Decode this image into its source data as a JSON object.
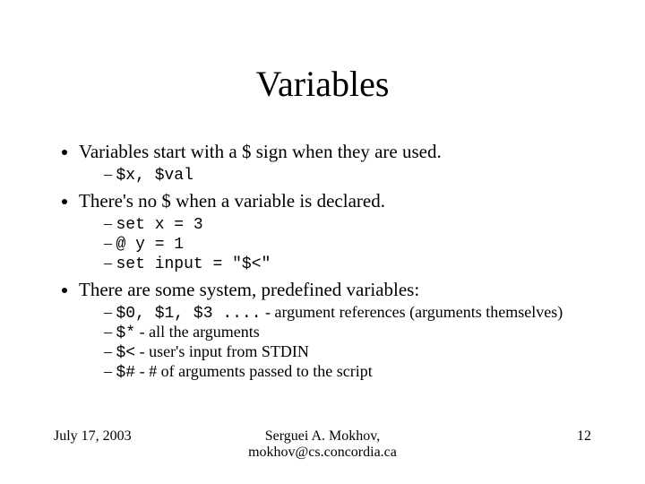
{
  "title": "Variables",
  "bullets": {
    "b1": "Variables start with a $ sign when they are used.",
    "b1_sub1": "$x, $val",
    "b2": " There's no $ when a variable is declared.",
    "b2_sub1": "set x = 3",
    "b2_sub2": "@ y = 1",
    "b2_sub3": "set input = \"$<\"",
    "b3": "There are some system, predefined variables:",
    "b3_sub1_code": "$0, $1, $3 ....",
    "b3_sub1_rest": " - argument references (arguments themselves)",
    "b3_sub2_code": "$*",
    "b3_sub2_rest": " - all the arguments",
    "b3_sub3_code": "$<",
    "b3_sub3_rest": " - user's input from STDIN",
    "b3_sub4_code": "$#",
    "b3_sub4_rest": " - # of arguments passed to the script"
  },
  "footer": {
    "date": "July 17, 2003",
    "author_line1": "Serguei A. Mokhov,",
    "author_line2": "mokhov@cs.concordia.ca",
    "page": "12"
  }
}
